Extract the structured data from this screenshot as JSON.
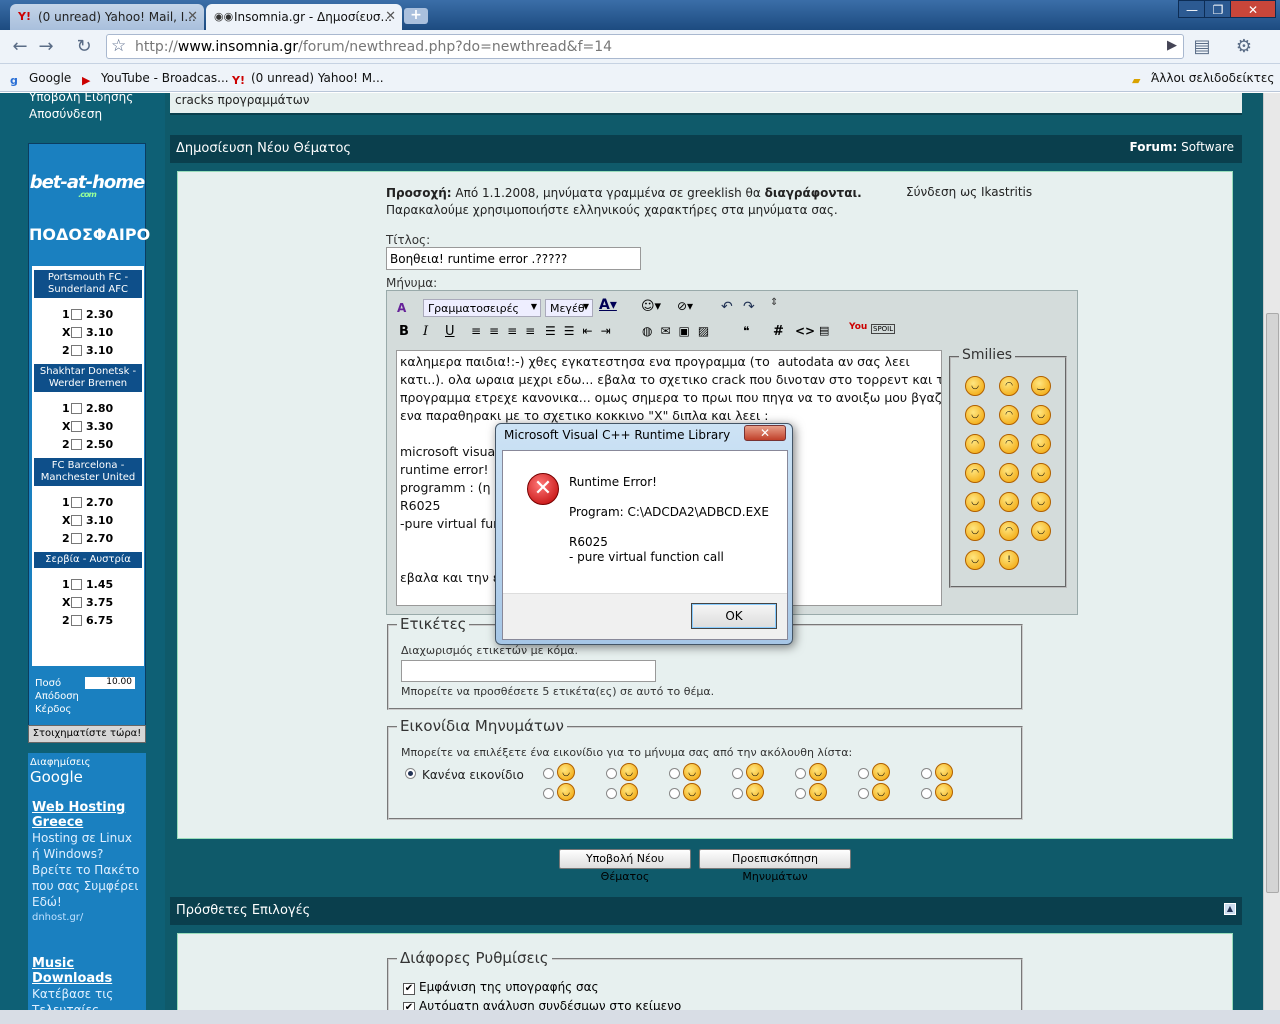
{
  "browser": {
    "tabs": [
      {
        "label": "(0 unread) Yahoo! Mail, I...",
        "favicon": "Y!"
      },
      {
        "label": "Insomnia.gr - Δημοσίευσ...",
        "favicon": "eyes"
      }
    ],
    "url_prefix": "http://",
    "url_domain": "www.insomnia.gr",
    "url_path": "/forum/newthread.php?do=newthread&f=14",
    "bookmarks": [
      {
        "label": "Google",
        "icon": "google-icon"
      },
      {
        "label": "YouTube - Broadcas...",
        "icon": "youtube-icon"
      },
      {
        "label": "(0 unread) Yahoo! M...",
        "icon": "yahoo-icon"
      }
    ],
    "other_bookmarks": "Άλλοι σελιδοδείκτες"
  },
  "sidebar": {
    "links": [
      "Υποβολή Είδησης",
      "Αποσύνδεση"
    ],
    "bet": {
      "brand": "bet-at-home",
      "brand_sub": ".com",
      "sport": "ΠΟΔΟΣΦΑΙΡΟ",
      "matches": [
        {
          "name": "Portsmouth FC - Sunderland AFC",
          "odds": [
            [
              "1",
              "2.30"
            ],
            [
              "X",
              "3.10"
            ],
            [
              "2",
              "3.10"
            ]
          ]
        },
        {
          "name": "Shakhtar Donetsk - Werder Bremen",
          "odds": [
            [
              "1",
              "2.80"
            ],
            [
              "X",
              "3.30"
            ],
            [
              "2",
              "2.50"
            ]
          ]
        },
        {
          "name": "FC Barcelona - Manchester United",
          "odds": [
            [
              "1",
              "2.70"
            ],
            [
              "X",
              "3.10"
            ],
            [
              "2",
              "2.70"
            ]
          ]
        },
        {
          "name": "Σερβία - Αυστρία",
          "odds": [
            [
              "1",
              "1.45"
            ],
            [
              "X",
              "3.75"
            ],
            [
              "2",
              "6.75"
            ]
          ]
        }
      ],
      "amount_label": "Ποσό",
      "amount_value": "10.00",
      "payout_label": "Απόδοση",
      "profit_label": "Κέρδος",
      "button": "Στοιχηματίστε τώρα!"
    },
    "ad": {
      "header_prefix": "Διαφημίσεις",
      "header_brand": "Google",
      "items": [
        {
          "title": "Web Hosting Greece",
          "text": "Hosting σε Linux ή Windows? Βρείτε το Πακέτο που σας Συμφέρει Εδώ!",
          "url": "dnhost.gr/"
        },
        {
          "title": "Music Downloads",
          "text": "Κατέβασε τις Τελευταίες Μουσικές Επιτυχίες στο",
          "url": ""
        }
      ]
    }
  },
  "top_snippet": "cracks προγραμμάτων",
  "post_panel": {
    "title": "Δημοσίευση Νέου Θέματος",
    "forum_label": "Forum:",
    "forum_name": "Software",
    "warning_bold": "Προσοχή:",
    "warning_text": "Από 1.1.2008, μηνύματα γραμμένα σε greeklish θα",
    "warning_bold2": "διαγράφονται.",
    "warning_line2": "Παρακαλούμε χρησιμοποιήστε ελληνικούς χαρακτήρες στα μηνύματα σας.",
    "logged_in": "Σύνδεση ως Ikastritis",
    "title_label": "Τίτλος:",
    "title_value": "Βοηθεια! runtime error .?????",
    "message_label": "Μήνυμα:",
    "font_select": "Γραμματοσειρές",
    "size_select": "Μεγέθ",
    "message_lines": [
      "καλημερα παιδια!:-) χθες εγκατεστησα ενα προγραμμα (το  autodata αν σας λεει",
      "κατι..). ολα ωραια μεχρι εδω... εβαλα το σχετικο crack που δινοταν στο τορρεντ και το",
      "προγραμμα ετρεχε κανονικα... ομως σημερα το πρωι που πηγα να το ανοιξω μου βγαζει",
      "ενα παραθηρακι με το σχετικο κοκκινο \"X\" διπλα και λεει :",
      "",
      "microsoft visual",
      "runtime error!",
      "programm : (η θ",
      "R6025",
      "-pure virtual fun",
      "",
      "",
      "εβαλα και την ει"
    ],
    "smilies_title": "Smilies",
    "tags_legend": "Ετικέτες",
    "tags_hint": "Διαχωρισμός ετικετών με κόμα.",
    "tags_value": "",
    "tags_note": "Μπορείτε να προσθέσετε 5 ετικέτα(ες) σε αυτό το θέμα.",
    "icons_legend": "Εικονίδια Μηνυμάτων",
    "icons_hint": "Μπορείτε να επιλέξετε ένα εικονίδιο για το μήνυμα σας από την ακόλουθη λίστα:",
    "no_icon": "Κανένα εικονίδιο",
    "submit": "Υποβολή Νέου Θέματος",
    "preview": "Προεπισκόπηση Μηνυμάτων"
  },
  "extra_panel": {
    "title": "Πρόσθετες Επιλογές",
    "misc_legend": "Διάφορες Ρυθμίσεις",
    "options": [
      {
        "label": "Εμφάνιση της υπογραφής σας",
        "checked": true
      },
      {
        "label": "Αυτόματη ανάλυση συνδέσμων στο κείμενο",
        "checked": true
      }
    ]
  },
  "dialog": {
    "title": "Microsoft Visual C++ Runtime Library",
    "close": "✕",
    "message": "Runtime Error!\n\nProgram: C:\\ADCDA2\\ADBCD.EXE\n\nR6025\n- pure virtual function call",
    "ok": "OK"
  }
}
